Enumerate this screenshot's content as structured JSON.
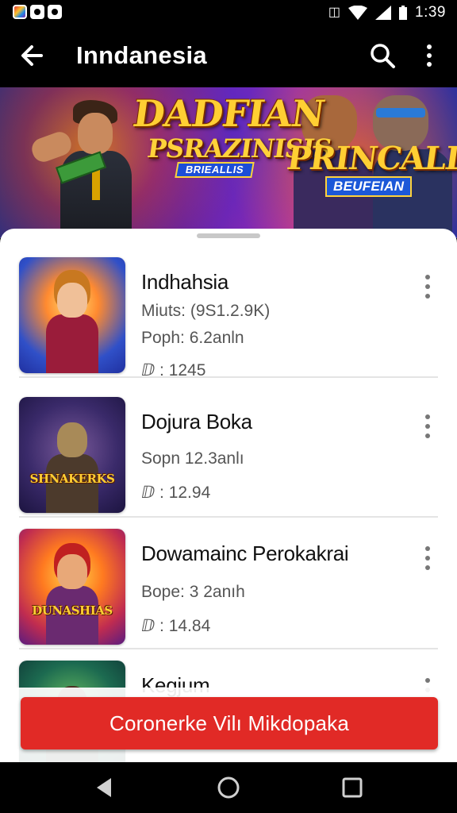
{
  "status_bar": {
    "time": "1:39",
    "left_icons": [
      "app-notification-icon",
      "notification-icon",
      "notification-icon"
    ],
    "right_icons": [
      "vibrate-icon",
      "wifi-icon",
      "signal-icon",
      "battery-icon"
    ]
  },
  "app_bar": {
    "title": "Inndanesia",
    "back_icon": "arrow-left-icon",
    "search_icon": "search-icon",
    "more_icon": "more-vertical-icon"
  },
  "banner": {
    "title": "DADFIAN",
    "subtitle": "PSRAZINISIS",
    "ribbon": "BRIEALLIS",
    "side_title": "PRINCALIS",
    "side_subtitle": "BEUFEIAN"
  },
  "list": {
    "items": [
      {
        "title": "Indhahsia",
        "lines": [
          "Miuts: (9S1.2.9K)",
          "Poph: 6.2anln",
          "ⅅ : 1245"
        ],
        "thumb_text": ""
      },
      {
        "title": "Dojura Boka",
        "lines": [
          "Sopn 12.3anlı",
          "ⅅ : 12.94"
        ],
        "thumb_text": "SHNAKERKS"
      },
      {
        "title": "Dowamainc Perokakrai",
        "lines": [
          "Bope: 3 2anıh",
          "ⅅ : 14.84"
        ],
        "thumb_text": "DUNASHIAS"
      },
      {
        "title": "Kegjum",
        "lines": [],
        "thumb_text": ""
      }
    ]
  },
  "cta": {
    "label": "Coronerke Vilı Mikdopaka"
  },
  "colors": {
    "accent": "#e12a26",
    "app_bar": "#000000",
    "title_gold": "#ffcf33"
  }
}
